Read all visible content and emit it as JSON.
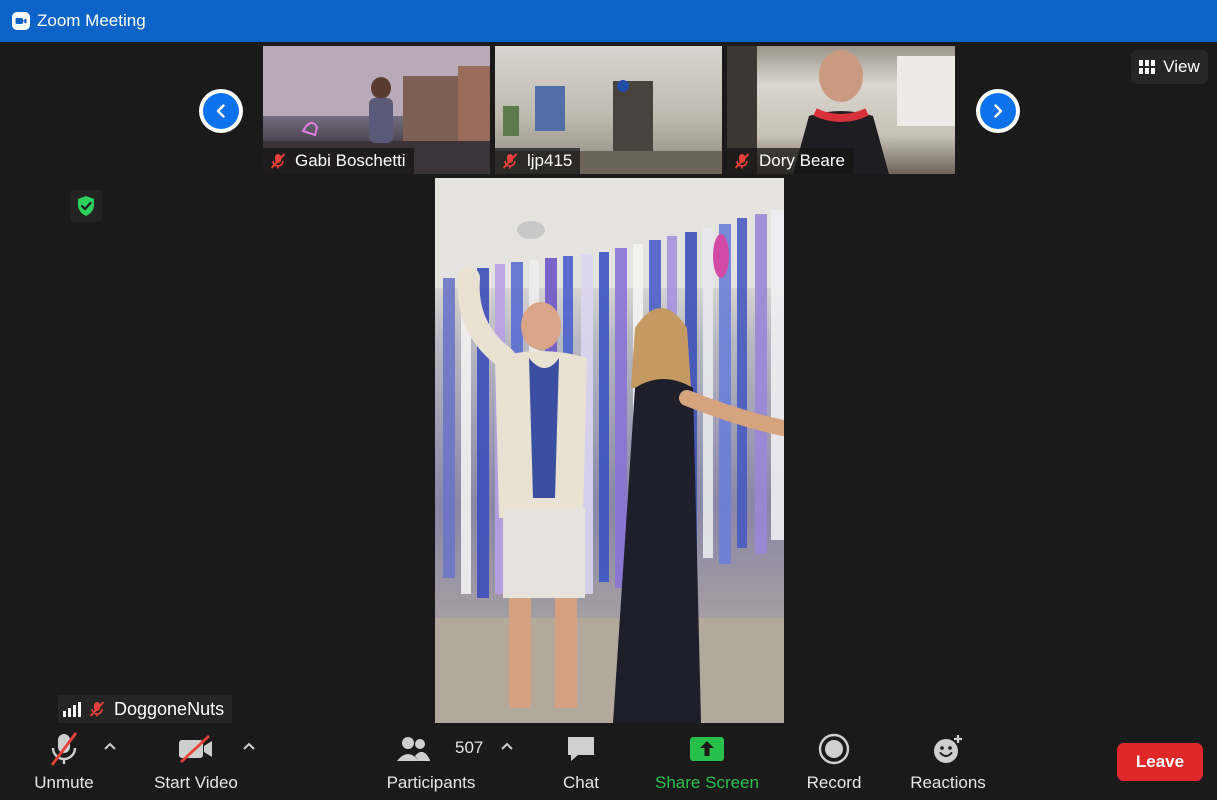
{
  "window": {
    "title": "Zoom Meeting",
    "accent": "#0c63c7"
  },
  "gallery": {
    "participants": [
      {
        "name": "Gabi Boschetti",
        "muted": true
      },
      {
        "name": "ljp415",
        "muted": true
      },
      {
        "name": "Dory Beare",
        "muted": true
      }
    ],
    "prev_icon": "chevron-left-icon",
    "next_icon": "chevron-right-icon"
  },
  "view_button": {
    "label": "View"
  },
  "self": {
    "name": "DoggoneNuts",
    "muted": true
  },
  "toolbar": {
    "unmute_label": "Unmute",
    "start_video_label": "Start Video",
    "participants_label": "Participants",
    "participants_count": "507",
    "chat_label": "Chat",
    "share_screen_label": "Share Screen",
    "record_label": "Record",
    "reactions_label": "Reactions",
    "leave_label": "Leave"
  },
  "colors": {
    "share_green": "#27c04a",
    "leave_red": "#e02828",
    "nav_blue": "#0e72ed",
    "shield_green": "#2bd15f"
  }
}
